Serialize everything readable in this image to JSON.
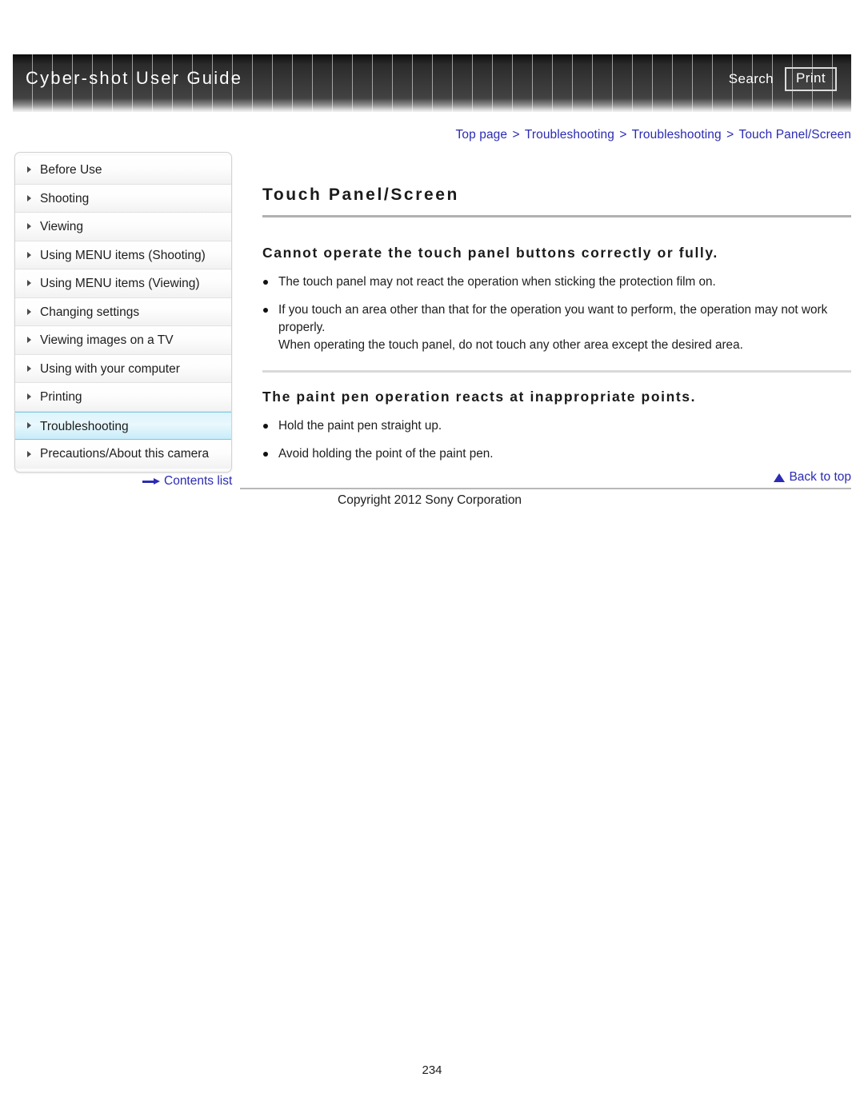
{
  "header": {
    "title": "Cyber-shot User Guide",
    "search_label": "Search",
    "print_label": "Print"
  },
  "breadcrumb": {
    "items": [
      {
        "label": "Top page"
      },
      {
        "label": "Troubleshooting"
      },
      {
        "label": "Troubleshooting"
      },
      {
        "label": "Touch Panel/Screen"
      }
    ],
    "separator": ">"
  },
  "sidebar": {
    "items": [
      {
        "label": "Before Use",
        "active": false
      },
      {
        "label": "Shooting",
        "active": false
      },
      {
        "label": "Viewing",
        "active": false
      },
      {
        "label": "Using MENU items (Shooting)",
        "active": false
      },
      {
        "label": "Using MENU items (Viewing)",
        "active": false
      },
      {
        "label": "Changing settings",
        "active": false
      },
      {
        "label": "Viewing images on a TV",
        "active": false
      },
      {
        "label": "Using with your computer",
        "active": false
      },
      {
        "label": "Printing",
        "active": false
      },
      {
        "label": "Troubleshooting",
        "active": true
      },
      {
        "label": "Precautions/About this camera",
        "active": false
      }
    ]
  },
  "main": {
    "page_title": "Touch Panel/Screen",
    "sections": [
      {
        "heading": "Cannot operate the touch panel buttons correctly or fully.",
        "bullets": [
          {
            "text": "The touch panel may not react the operation when sticking the protection film on.",
            "extra": ""
          },
          {
            "text": "If you touch an area other than that for the operation you want to perform, the operation may not work properly.",
            "extra": "When operating the touch panel, do not touch any other area except the desired area."
          }
        ]
      },
      {
        "heading": "The paint pen operation reacts at inappropriate points.",
        "bullets": [
          {
            "text": "Hold the paint pen straight up.",
            "extra": ""
          },
          {
            "text": "Avoid holding the point of the paint pen.",
            "extra": ""
          }
        ]
      }
    ]
  },
  "footer": {
    "contents_list_label": "Contents list",
    "back_to_top_label": "Back to top",
    "copyright": "Copyright 2012 Sony Corporation",
    "page_number": "234"
  },
  "colors": {
    "link": "#2b2bb5",
    "active_nav": "#d5f1fa",
    "banner_dark": "#2b2b2b"
  }
}
